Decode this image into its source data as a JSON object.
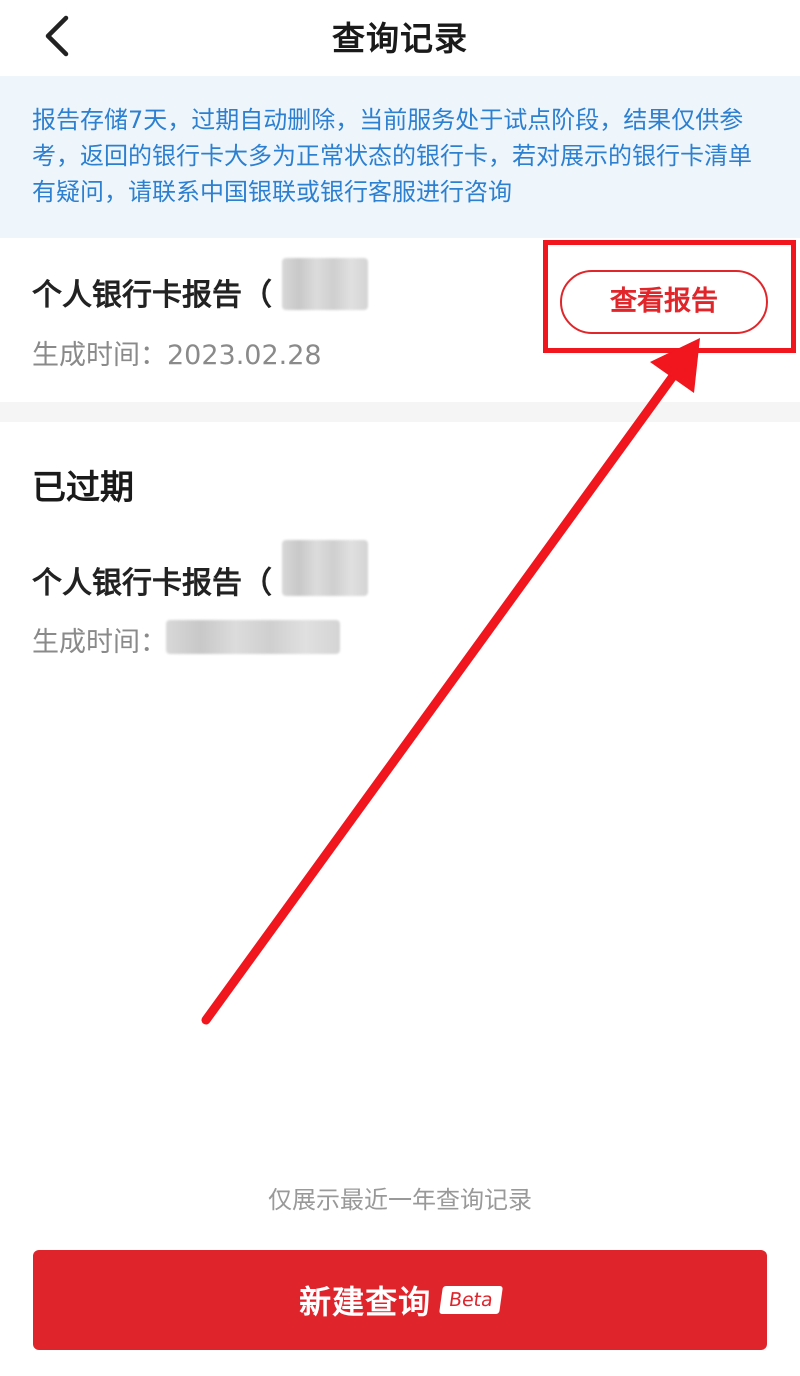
{
  "header": {
    "title": "查询记录",
    "back_icon": "chevron-left-icon"
  },
  "notice": {
    "text": "报告存储7天，过期自动删除，当前服务处于试点阶段，结果仅供参考，返回的银行卡大多为正常状态的银行卡，若对展示的银行卡清单有疑问，请联系中国银联或银行客服进行咨询"
  },
  "active_report": {
    "title": "个人银行卡报告（",
    "time_label": "生成时间：",
    "time_value": "2023.02.28",
    "view_button": "查看报告"
  },
  "expired_section": {
    "title": "已过期",
    "report": {
      "title": "个人银行卡报告（",
      "time_label": "生成时间："
    }
  },
  "footer": {
    "note": "仅展示最近一年查询记录",
    "new_query_button": "新建查询",
    "beta_badge": "Beta"
  },
  "colors": {
    "accent_red": "#e0242c",
    "notice_text_blue": "#2d7fd0",
    "notice_background": "#eef6fc",
    "annotation_red": "#f1151d"
  }
}
